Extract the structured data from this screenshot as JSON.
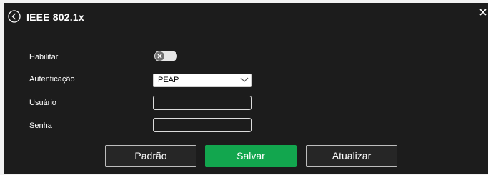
{
  "header": {
    "title": "IEEE 802.1x",
    "back_icon": "chevron-left-circle-icon",
    "close_icon": "close-icon"
  },
  "form": {
    "enable_label": "Habilitar",
    "enable_state": false,
    "auth_label": "Autenticação",
    "auth_value": "PEAP",
    "user_label": "Usuário",
    "user_value": "",
    "password_label": "Senha",
    "password_value": ""
  },
  "buttons": {
    "default_label": "Padrão",
    "save_label": "Salvar",
    "refresh_label": "Atualizar"
  },
  "colors": {
    "background": "#1c1c1c",
    "primary": "#12a64e"
  }
}
